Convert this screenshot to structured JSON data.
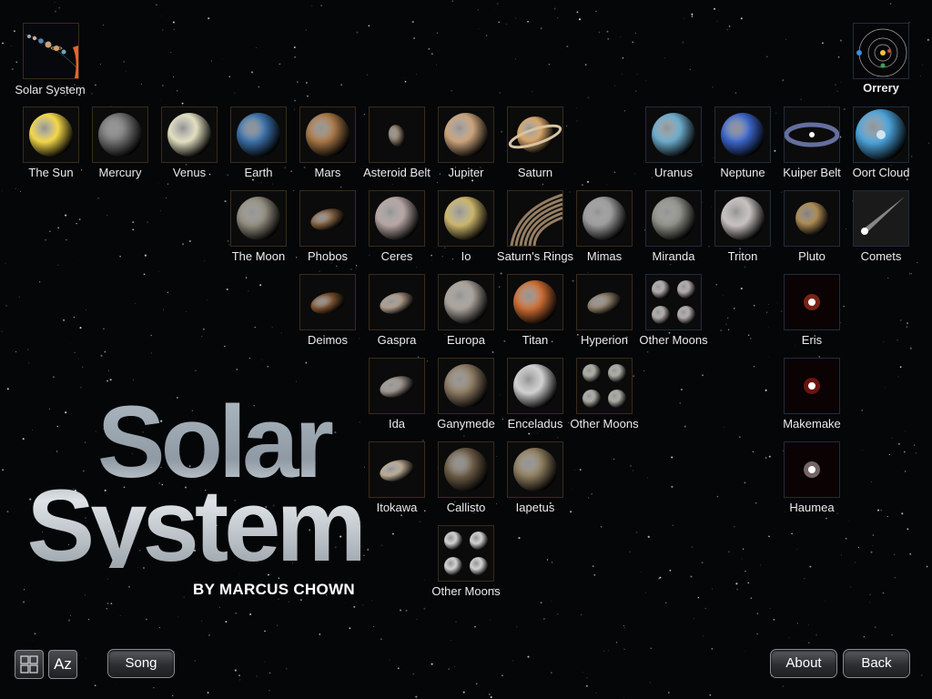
{
  "top_left_tile": {
    "label": "Solar System",
    "icon": "solar-system-planets-icon"
  },
  "top_right_tile": {
    "label": "Orrery",
    "icon": "orrery-icon"
  },
  "tiles": [
    {
      "label": "The Sun",
      "icon": "sun-icon",
      "color": "#f3d64a"
    },
    {
      "label": "Mercury",
      "icon": "mercury-icon",
      "color": "#6e6e6e"
    },
    {
      "label": "Venus",
      "icon": "venus-icon",
      "color": "#e2dfc0"
    },
    {
      "label": "Earth",
      "icon": "earth-icon",
      "color": "#3a6ea6"
    },
    {
      "label": "Mars",
      "icon": "mars-icon",
      "color": "#a47444"
    },
    {
      "label": "Asteroid Belt",
      "icon": "asteroid-belt-icon",
      "color": "#8a7a68"
    },
    {
      "label": "Jupiter",
      "icon": "jupiter-icon",
      "color": "#c9a27a"
    },
    {
      "label": "Saturn",
      "icon": "saturn-icon",
      "color": "#d6a56a"
    },
    {
      "label": "Uranus",
      "icon": "uranus-icon",
      "color": "#6aa9c9"
    },
    {
      "label": "Neptune",
      "icon": "neptune-icon",
      "color": "#3b64c8"
    },
    {
      "label": "Kuiper Belt",
      "icon": "kuiper-belt-icon",
      "color": "#7a88c4"
    },
    {
      "label": "Oort Cloud",
      "icon": "oort-cloud-icon",
      "color": "#4aa0d8"
    },
    {
      "label": "The Moon",
      "icon": "moon-icon",
      "color": "#8e8a7c"
    },
    {
      "label": "Phobos",
      "icon": "phobos-icon",
      "color": "#7e5e40"
    },
    {
      "label": "Ceres",
      "icon": "ceres-icon",
      "color": "#b4a4a2"
    },
    {
      "label": "Io",
      "icon": "io-icon",
      "color": "#c9b46a"
    },
    {
      "label": "Saturn's Rings",
      "icon": "saturn-rings-icon",
      "color": "#b89a78"
    },
    {
      "label": "Mimas",
      "icon": "mimas-icon",
      "color": "#9a9a9a"
    },
    {
      "label": "Miranda",
      "icon": "miranda-icon",
      "color": "#8e8e86"
    },
    {
      "label": "Triton",
      "icon": "triton-icon",
      "color": "#c8c0c0"
    },
    {
      "label": "Pluto",
      "icon": "pluto-icon",
      "color": "#c8a060"
    },
    {
      "label": "Comets",
      "icon": "comet-icon",
      "color": "#dcdcdc"
    },
    {
      "label": "Deimos",
      "icon": "deimos-icon",
      "color": "#7a5232"
    },
    {
      "label": "Gaspra",
      "icon": "gaspra-icon",
      "color": "#a89684"
    },
    {
      "label": "Europa",
      "icon": "europa-icon",
      "color": "#a7a098"
    },
    {
      "label": "Titan",
      "icon": "titan-icon",
      "color": "#c86a32"
    },
    {
      "label": "Hyperion",
      "icon": "hyperion-icon",
      "color": "#8a7a66"
    },
    {
      "label": "Other Moons",
      "icon": "other-moons-icon",
      "color": "#b0a8a8"
    },
    {
      "label": "Eris",
      "icon": "eris-icon",
      "color": "#ff4a2a"
    },
    {
      "label": "Ida",
      "icon": "ida-icon",
      "color": "#9a9088"
    },
    {
      "label": "Ganymede",
      "icon": "ganymede-icon",
      "color": "#8a7860"
    },
    {
      "label": "Enceladus",
      "icon": "enceladus-icon",
      "color": "#d0d0d0"
    },
    {
      "label": "Other Moons",
      "icon": "other-moons-icon",
      "color": "#a8a8a0"
    },
    {
      "label": "Makemake",
      "icon": "makemake-icon",
      "color": "#e02a1a"
    },
    {
      "label": "Itokawa",
      "icon": "itokawa-icon",
      "color": "#b8a890"
    },
    {
      "label": "Callisto",
      "icon": "callisto-icon",
      "color": "#6a5a44"
    },
    {
      "label": "Iapetus",
      "icon": "iapetus-icon",
      "color": "#8a7a5c"
    },
    {
      "label": "Haumea",
      "icon": "haumea-icon",
      "color": "#f6e0e0"
    },
    {
      "label": "Other Moons",
      "icon": "other-moons-icon",
      "color": "#d0d0d0"
    }
  ],
  "title": {
    "line1": "Solar",
    "line2": "System",
    "byline": "BY MARCUS CHOWN"
  },
  "toolbar": {
    "grid_view": "grid-view-icon",
    "az_label": "Az",
    "song_label": "Song",
    "about_label": "About",
    "back_label": "Back"
  }
}
